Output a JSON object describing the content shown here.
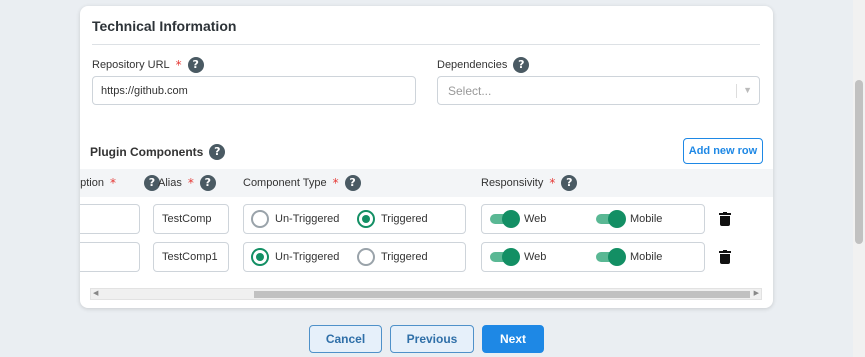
{
  "technical_info": {
    "title": "Technical Information",
    "repository_url_label": "Repository URL",
    "repository_url_value": "https://github.com",
    "dependencies_label": "Dependencies",
    "dependencies_placeholder": "Select...",
    "required_mark": "*",
    "help_glyph": "?"
  },
  "plugin_components": {
    "title": "Plugin Components",
    "add_row_label": "Add new row",
    "columns": {
      "description": "ription",
      "alias": "Alias",
      "component_type": "Component Type",
      "responsivity": "Responsivity"
    },
    "rows": [
      {
        "description": "",
        "alias": "TestComp",
        "component_type_options": [
          "Un-Triggered",
          "Triggered"
        ],
        "component_type_selected": "Triggered",
        "web_label": "Web",
        "web_on": true,
        "mobile_label": "Mobile",
        "mobile_on": true
      },
      {
        "description": "",
        "alias": "TestComp1",
        "component_type_options": [
          "Un-Triggered",
          "Triggered"
        ],
        "component_type_selected": "Un-Triggered",
        "web_label": "Web",
        "web_on": true,
        "mobile_label": "Mobile",
        "mobile_on": true
      }
    ]
  },
  "footer": {
    "cancel_label": "Cancel",
    "previous_label": "Previous",
    "next_label": "Next"
  },
  "icons": [
    "help-icon",
    "trash-icon",
    "chevron-down-icon",
    "scroll-left-arrow-icon",
    "scroll-right-arrow-icon"
  ],
  "colors": {
    "accent_blue": "#1e88e5",
    "toggle_green": "#138f64",
    "required_red": "#e53935"
  }
}
